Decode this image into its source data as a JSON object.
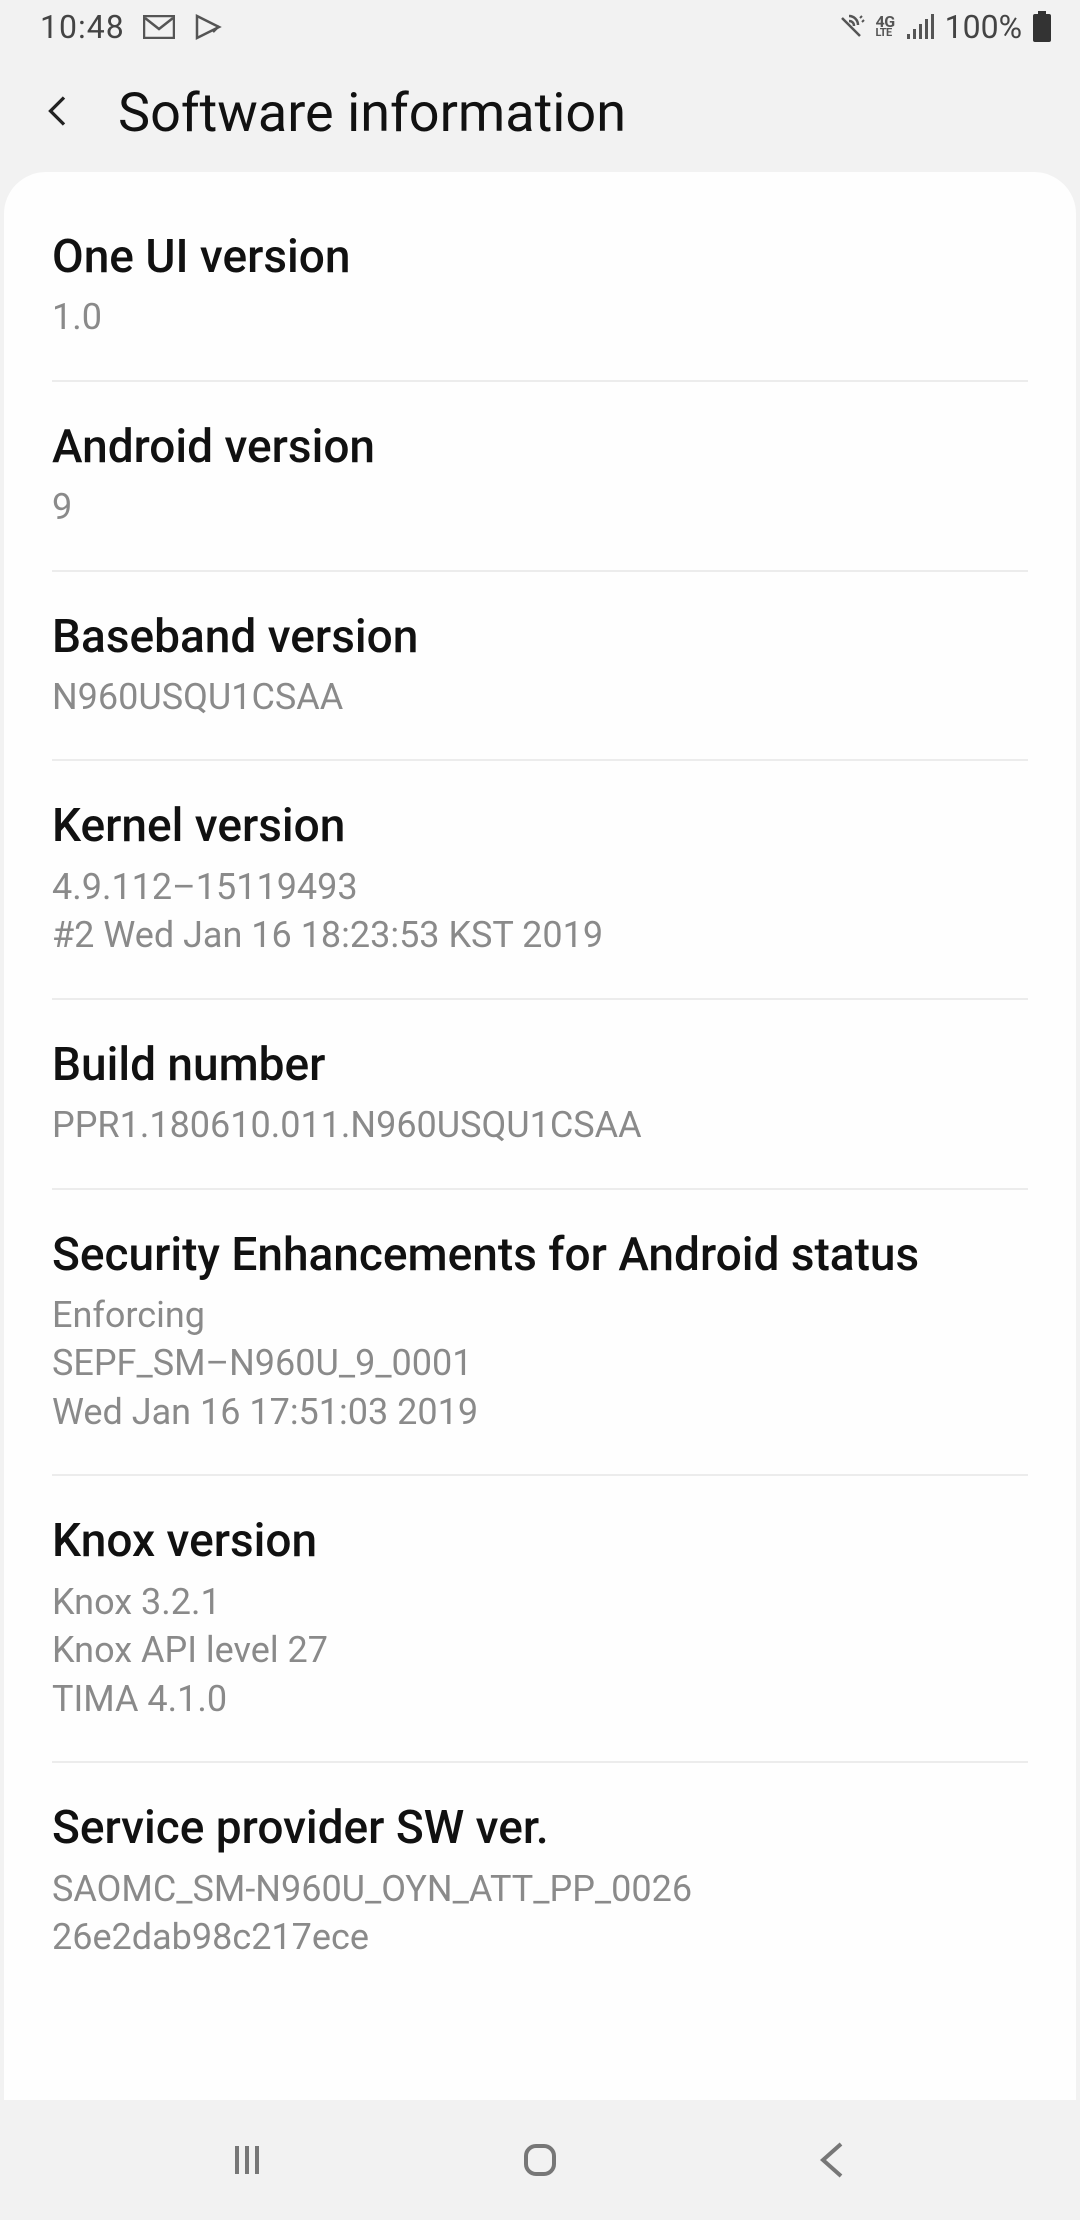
{
  "status": {
    "time": "10:48",
    "battery_text": "100%"
  },
  "header": {
    "title": "Software information"
  },
  "rows": [
    {
      "title": "One UI version",
      "value": "1.0"
    },
    {
      "title": "Android version",
      "value": "9"
    },
    {
      "title": "Baseband version",
      "value": "N960USQU1CSAA"
    },
    {
      "title": "Kernel version",
      "value": "4.9.112–15119493\n#2 Wed Jan 16 18:23:53 KST 2019"
    },
    {
      "title": "Build number",
      "value": "PPR1.180610.011.N960USQU1CSAA"
    },
    {
      "title": "Security Enhancements for Android status",
      "value": "Enforcing\nSEPF_SM–N960U_9_0001\nWed Jan 16 17:51:03 2019"
    },
    {
      "title": "Knox version",
      "value": "Knox 3.2.1\nKnox API level 27\nTIMA 4.1.0"
    },
    {
      "title": "Service provider SW ver.",
      "value": "SAOMC_SM-N960U_OYN_ATT_PP_0026\n26e2dab98c217ece"
    }
  ]
}
